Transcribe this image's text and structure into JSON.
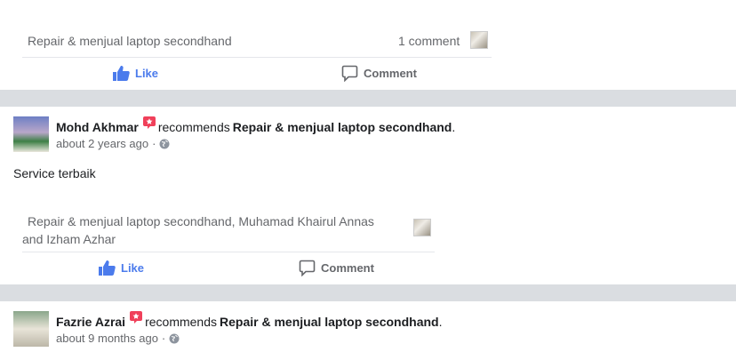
{
  "post1": {
    "page_name": "Repair & menjual laptop secondhand",
    "comment_count": "1 comment",
    "like_label": "Like",
    "comment_label": "Comment"
  },
  "post2": {
    "author": "Mohd Akhmar",
    "recommends": "recommends",
    "page": "Repair & menjual laptop secondhand",
    "time": "about 2 years ago",
    "text": "Service terbaik",
    "likers_line1": "Repair & menjual laptop secondhand, Muhamad Khairul Annas",
    "likers_line2": "and Izham Azhar",
    "like_label": "Like",
    "comment_label": "Comment"
  },
  "post3": {
    "author": "Fazrie Azrai",
    "recommends": "recommends",
    "page": "Repair & menjual laptop secondhand",
    "time": "about 9 months ago"
  },
  "colors": {
    "like": "#4b7bec",
    "badge": "#f0405a",
    "divider": "#dadde1"
  },
  "icons": [
    "thumbs-up-icon",
    "comment-icon",
    "globe-icon",
    "recommend-badge-icon"
  ]
}
